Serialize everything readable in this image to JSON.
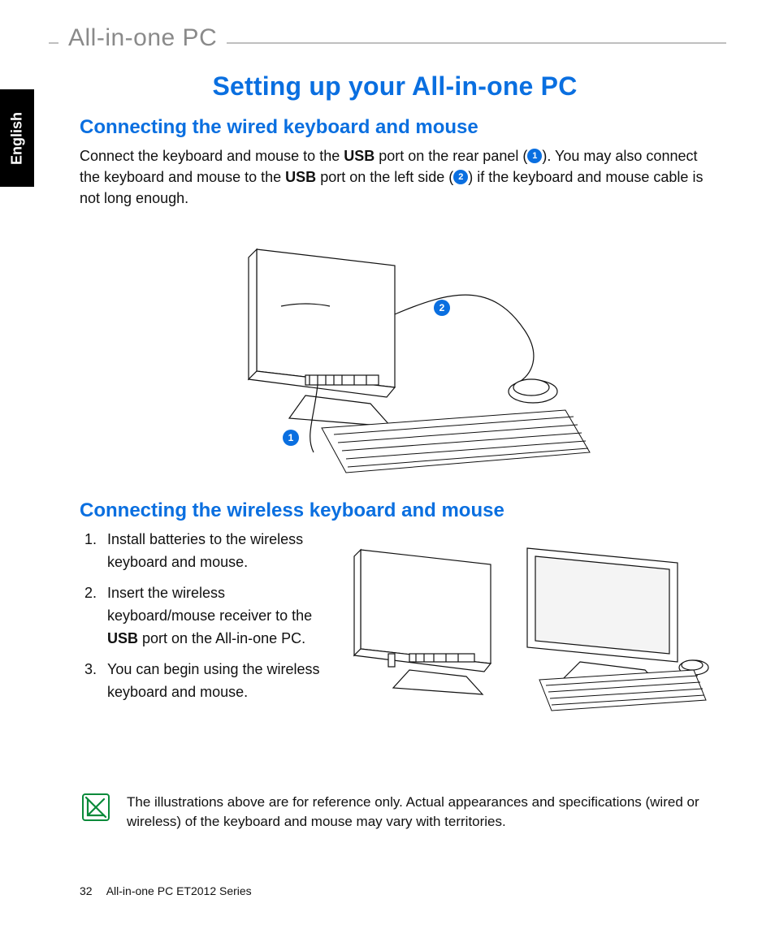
{
  "header": {
    "product_line": "All-in-one PC"
  },
  "language_tab": "English",
  "title": "Setting up your All-in-one PC",
  "section1": {
    "heading": "Connecting the wired keyboard and mouse",
    "p_pre1": "Connect the keyboard and mouse to the ",
    "usb1": "USB",
    "p_mid1": " port on the rear panel (",
    "badge1": "1",
    "p_mid2": "). You may also connect the keyboard and mouse to the ",
    "usb2": "USB",
    "p_mid3": " port on the left side (",
    "badge2": "2",
    "p_end": ") if the keyboard and mouse cable is not long enough.",
    "callout1": "1",
    "callout2": "2"
  },
  "section2": {
    "heading": "Connecting the wireless keyboard and mouse",
    "steps": [
      "Install batteries to the wireless keyboard and mouse.",
      "Insert the wireless keyboard/mouse receiver to the USB port on the All-in-one PC.",
      "You can begin using the wireless keyboard and mouse."
    ],
    "step2_pre": "Insert the wireless keyboard/mouse receiver to the ",
    "step2_bold": "USB",
    "step2_post": " port on the All-in-one PC."
  },
  "note": "The illustrations above are for reference only. Actual appearances and specifications (wired or wireless) of the keyboard and mouse may vary with territories.",
  "footer": {
    "page_number": "32",
    "product": "All-in-one PC ET2012 Series"
  }
}
